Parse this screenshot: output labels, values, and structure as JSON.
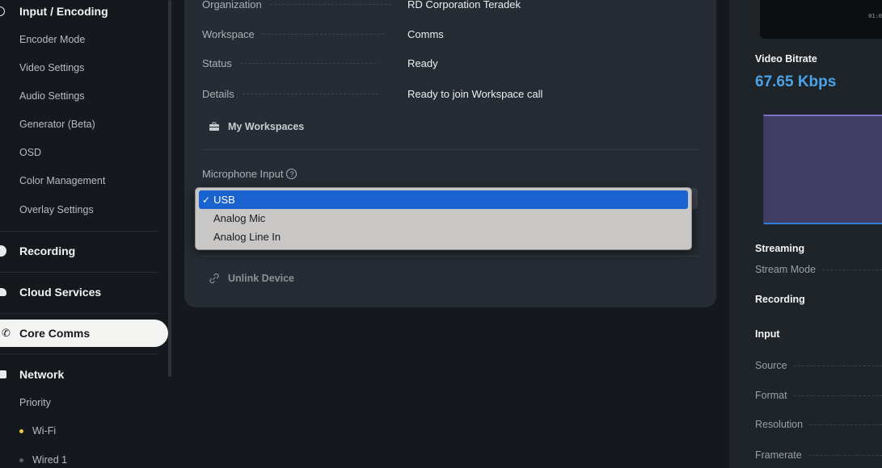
{
  "sidebar": {
    "input_encoding": {
      "title": "Input / Encoding",
      "items": [
        "Encoder Mode",
        "Video Settings",
        "Audio Settings",
        "Generator (Beta)",
        "OSD",
        "Color Management",
        "Overlay Settings"
      ]
    },
    "recording": "Recording",
    "cloud_services": "Cloud Services",
    "core_comms": "Core Comms",
    "network": {
      "title": "Network",
      "items": [
        {
          "label": "Priority"
        },
        {
          "label": "Wi-Fi",
          "dot_color": "#f5c542"
        },
        {
          "label": "Wired 1",
          "dot_color": "#5a6066"
        }
      ]
    }
  },
  "main": {
    "rows": [
      {
        "key": "Organization",
        "value": "RD Corporation Teradek"
      },
      {
        "key": "Workspace",
        "value": "Comms"
      },
      {
        "key": "Status",
        "value": "Ready"
      },
      {
        "key": "Details",
        "value": "Ready to join Workspace call"
      }
    ],
    "my_workspaces": "My Workspaces",
    "microphone_input_label": "Microphone Input",
    "help_glyph": "?",
    "unlink_device": "Unlink Device"
  },
  "mic_menu": {
    "options": [
      "USB",
      "Analog Mic",
      "Analog Line In"
    ],
    "selected": "USB",
    "check": "✓",
    "selected_color": "#1a62cf"
  },
  "right_panel": {
    "timecode": "01:0",
    "video_bitrate_title": "Video Bitrate",
    "video_bitrate_value": "67.65 Kbps",
    "streaming_title": "Streaming",
    "stream_mode_label": "Stream Mode",
    "recording_title": "Recording",
    "input_title": "Input",
    "input_rows": [
      "Source",
      "Format",
      "Resolution",
      "Framerate"
    ],
    "accent": "#4aa3e8"
  }
}
